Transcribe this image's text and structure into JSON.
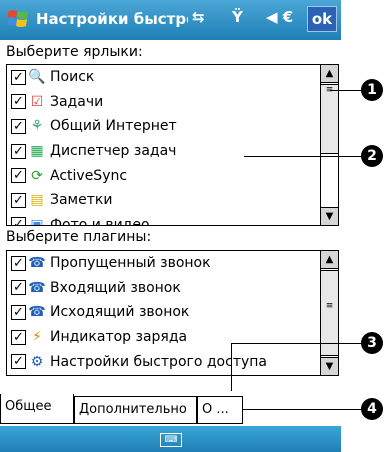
{
  "title_bar": {
    "title": "Настройки быстрогс",
    "status_icons": [
      "connectivity-icon",
      "antenna-icon",
      "speaker-icon"
    ],
    "ok_label": "ok"
  },
  "shortcuts": {
    "label": "Выберите ярлыки:",
    "items": [
      {
        "label": "Поиск",
        "checked": true,
        "icon": "search-icon"
      },
      {
        "label": "Задачи",
        "checked": true,
        "icon": "tasks-icon"
      },
      {
        "label": "Общий Интернет",
        "checked": true,
        "icon": "internet-sharing-icon"
      },
      {
        "label": "Диспетчер задач",
        "checked": true,
        "icon": "task-manager-icon"
      },
      {
        "label": "ActiveSync",
        "checked": true,
        "icon": "activesync-icon"
      },
      {
        "label": "Заметки",
        "checked": true,
        "icon": "notes-icon"
      },
      {
        "label": "Фото и видео",
        "checked": true,
        "icon": "photos-icon"
      }
    ]
  },
  "plugins": {
    "label": "Выберите плагины:",
    "items": [
      {
        "label": "Пропущенный звонок",
        "checked": true,
        "icon": "missed-call-icon"
      },
      {
        "label": "Входящий звонок",
        "checked": true,
        "icon": "incoming-call-icon"
      },
      {
        "label": "Исходящий звонок",
        "checked": true,
        "icon": "outgoing-call-icon"
      },
      {
        "label": "Индикатор заряда",
        "checked": true,
        "icon": "battery-indicator-icon"
      },
      {
        "label": "Настройки быстрого доступа",
        "checked": true,
        "icon": "quick-settings-icon"
      }
    ]
  },
  "tabs": [
    {
      "label": "Общее",
      "active": true
    },
    {
      "label": "Дополнительно",
      "active": false
    },
    {
      "label": "О ...",
      "active": false
    }
  ],
  "callouts": [
    "1",
    "2",
    "3",
    "4"
  ],
  "colors": {
    "title_bar": "#1f7fb5",
    "ok_button": "#2b62b3"
  }
}
